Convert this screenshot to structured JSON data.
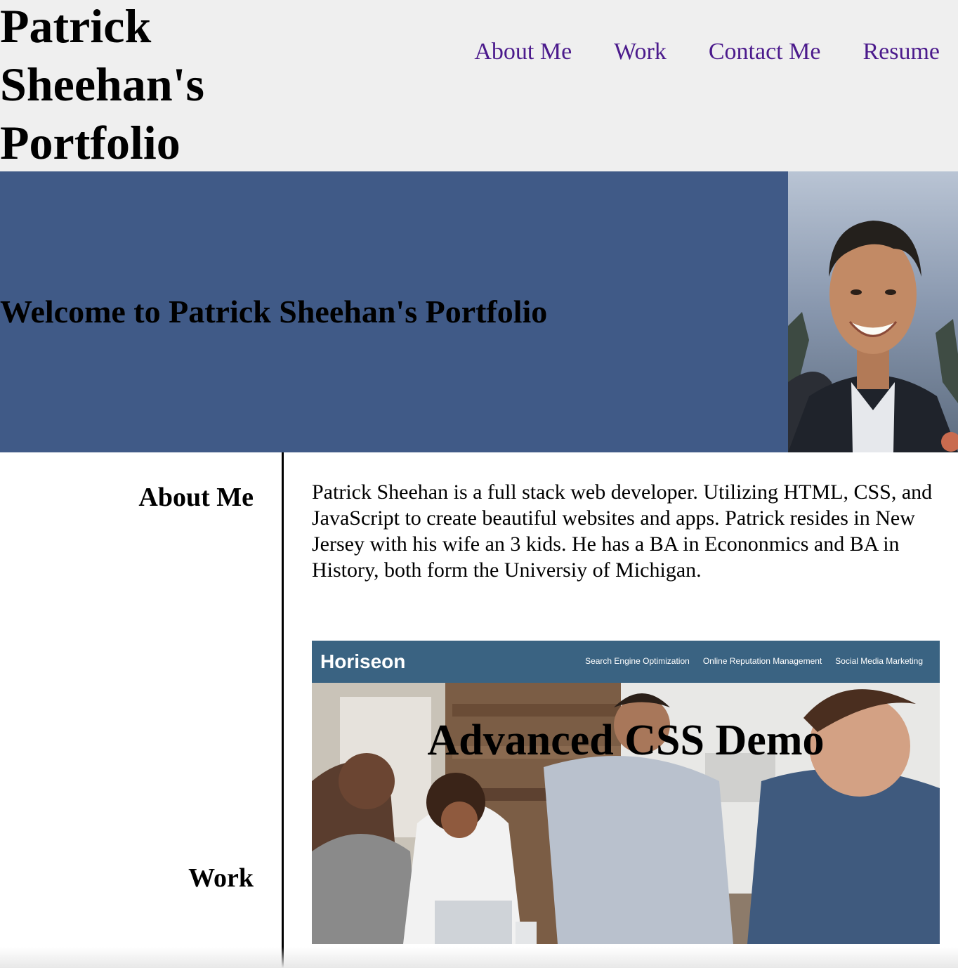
{
  "header": {
    "title": "Patrick Sheehan's Portfolio",
    "nav": [
      "About Me",
      "Work",
      "Contact Me",
      "Resume"
    ]
  },
  "hero": {
    "heading": "Welcome to Patrick Sheehan's Portfolio",
    "bg_color": "#405a87"
  },
  "about": {
    "heading": "About Me",
    "text": "Patrick Sheehan is a full stack web developer. Utilizing HTML, CSS, and JavaScript to create beautiful websites and apps. Patrick resides in New Jersey with his wife an 3 kids. He has a BA in Econonmics and BA in History, both form the Universiy of Michigan."
  },
  "work": {
    "heading": "Work",
    "project": {
      "title": "Advanced CSS Demo",
      "brand": "Horiseon",
      "links": [
        "Search Engine Optimization",
        "Online Reputation Management",
        "Social Media Marketing"
      ]
    }
  },
  "colors": {
    "nav_link": "#4b1a8c",
    "header_bg": "#efefef",
    "project_bar": "#3a6382"
  }
}
